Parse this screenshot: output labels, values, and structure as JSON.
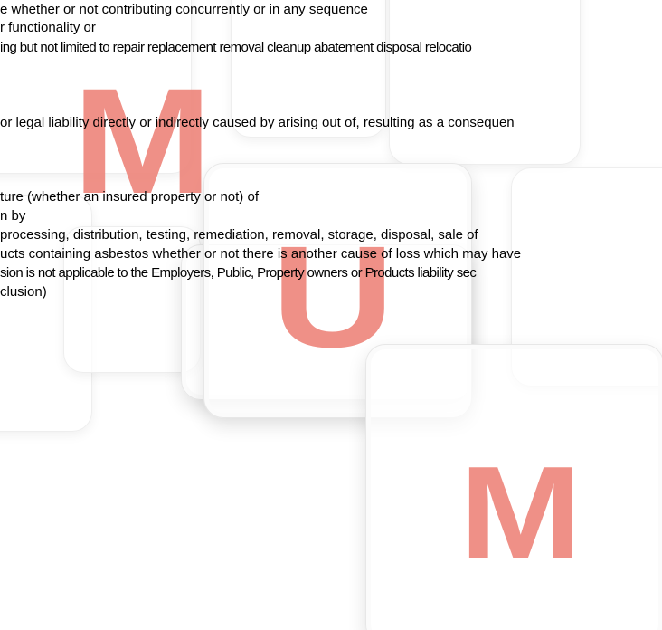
{
  "watermark": {
    "letters": [
      "M",
      "U",
      "M"
    ],
    "color": "#ee877d"
  },
  "document": {
    "lines": [
      "e whether or not contributing concurrently or in any sequence",
      "r functionality or",
      "ing but not limited to repair replacement removal cleanup abatement disposal relocatio",
      "or legal liability directly or indirectly caused by arising out of, resulting as a consequen",
      "ture (whether an insured property or not) of",
      "n by",
      " processing, distribution, testing, remediation, removal, storage, disposal, sale of",
      "ucts containing asbestos whether or not there is another cause of loss which may have",
      "sion is not applicable to the Employers, Public, Property owners or Products liability sec",
      "clusion)"
    ]
  }
}
